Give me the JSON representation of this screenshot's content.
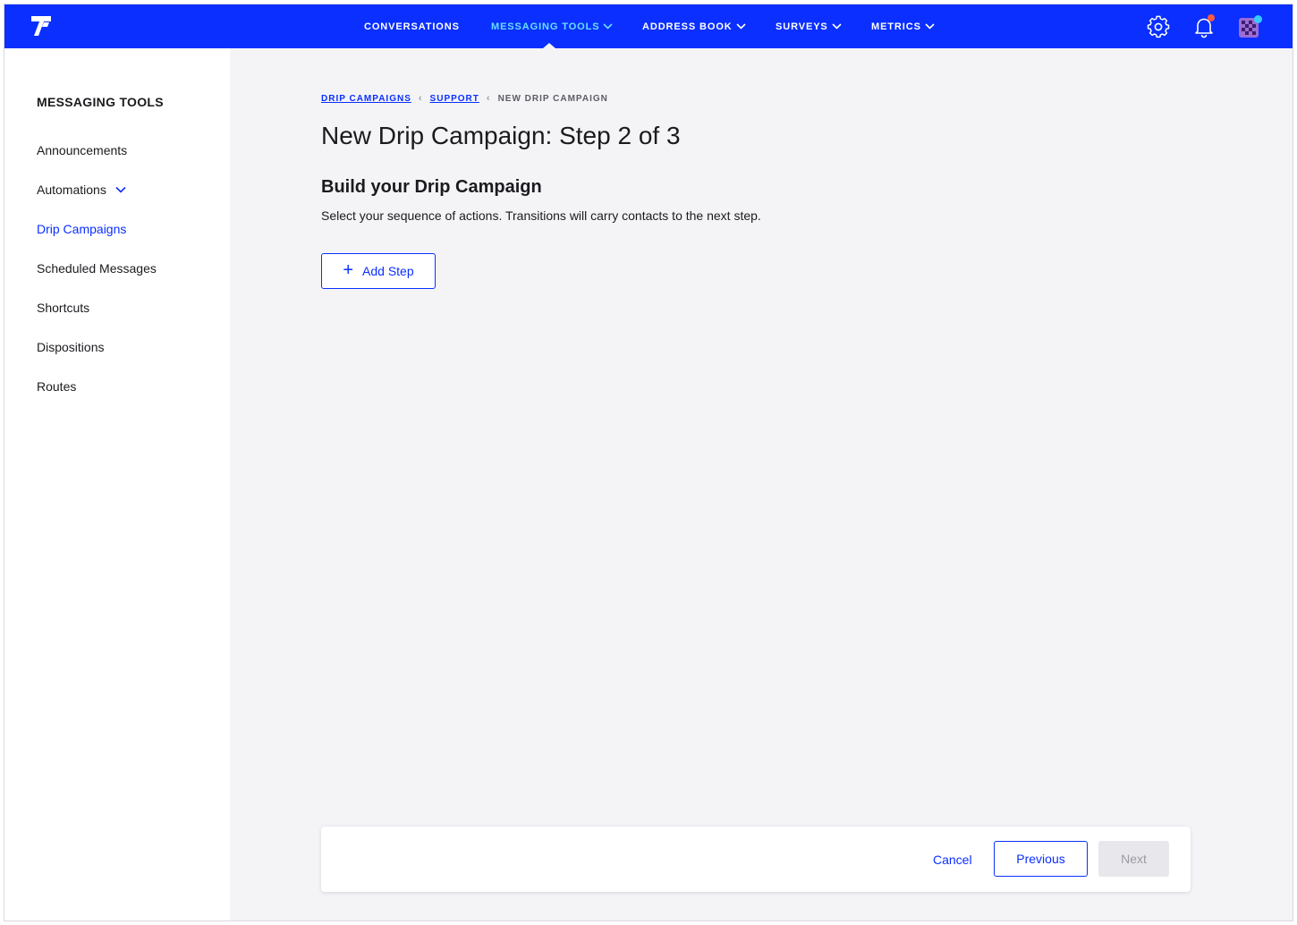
{
  "nav": {
    "items": [
      {
        "label": "CONVERSATIONS",
        "has_dropdown": false,
        "active": false
      },
      {
        "label": "MESSAGING TOOLS",
        "has_dropdown": true,
        "active": true
      },
      {
        "label": "ADDRESS BOOK",
        "has_dropdown": true,
        "active": false
      },
      {
        "label": "SURVEYS",
        "has_dropdown": true,
        "active": false
      },
      {
        "label": "METRICS",
        "has_dropdown": true,
        "active": false
      }
    ],
    "icons": [
      "settings-gear-icon",
      "notification-bell-icon",
      "user-avatar"
    ],
    "colors": {
      "bar": "#0a2fff",
      "active_item": "#66e0ff",
      "bell_badge": "#ff5a3c",
      "avatar_badge": "#33ccff"
    }
  },
  "sidebar": {
    "title": "MESSAGING TOOLS",
    "items": [
      {
        "label": "Announcements",
        "active": false
      },
      {
        "label": "Automations",
        "active": false,
        "expandable": true
      },
      {
        "label": "Drip Campaigns",
        "active": true
      },
      {
        "label": "Scheduled Messages",
        "active": false
      },
      {
        "label": "Shortcuts",
        "active": false
      },
      {
        "label": "Dispositions",
        "active": false
      },
      {
        "label": "Routes",
        "active": false
      }
    ]
  },
  "breadcrumb": {
    "items": [
      "DRIP CAMPAIGNS",
      "SUPPORT"
    ],
    "current": "NEW DRIP CAMPAIGN"
  },
  "page": {
    "title": "New Drip Campaign: Step 2 of 3",
    "section_title": "Build your Drip Campaign",
    "section_desc": "Select your sequence of actions. Transitions will carry contacts to the next step.",
    "add_step_label": "Add Step"
  },
  "actions": {
    "cancel": "Cancel",
    "previous": "Previous",
    "next": "Next",
    "next_disabled": true
  }
}
